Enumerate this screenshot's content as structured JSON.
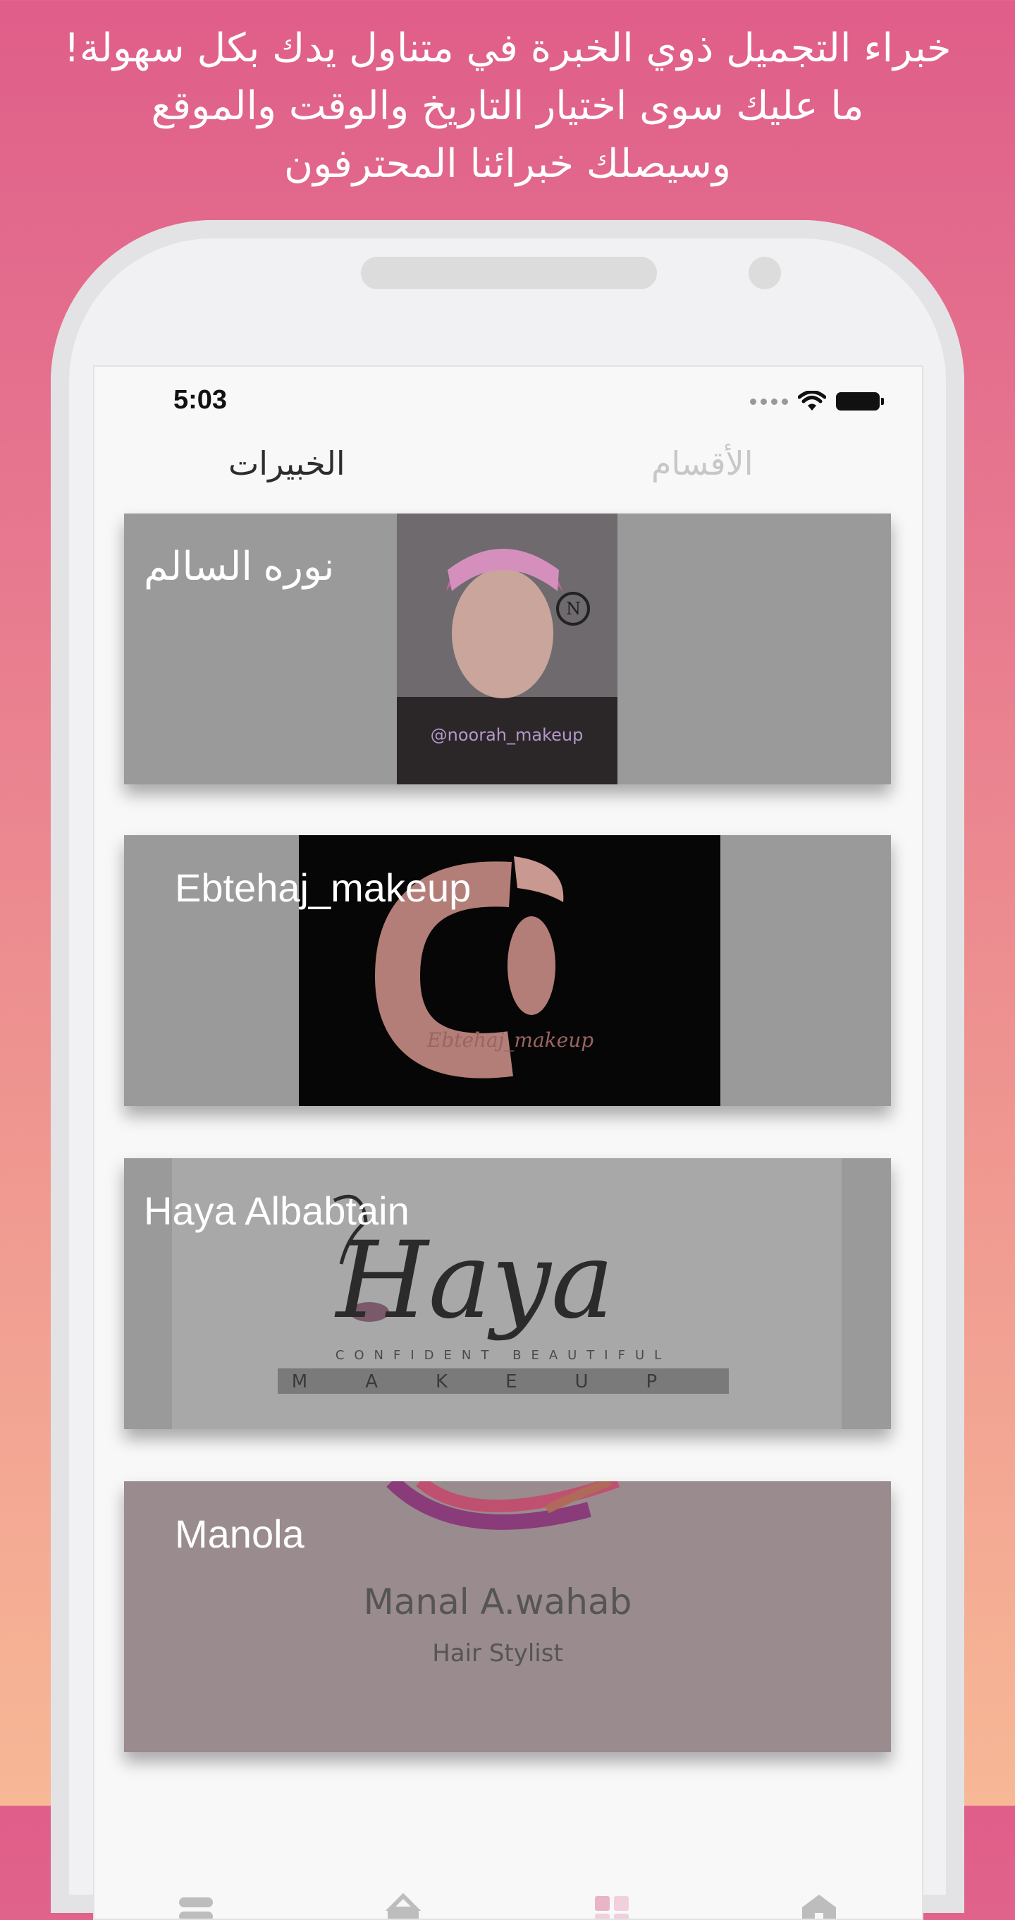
{
  "promo": {
    "lines": [
      "خبراء التجميل ذوي الخبرة في متناول يدك بكل سهولة!",
      "ما عليك سوى اختيار التاريخ والوقت والموقع",
      "وسيصلك خبرائنا المحترفون"
    ]
  },
  "status_bar": {
    "time": "5:03"
  },
  "tabs": {
    "experts": "الخبيرات",
    "sections": "الأقسام",
    "active": "experts"
  },
  "experts": [
    {
      "name": "نوره السالم",
      "image_caption": "@noorah_makeup"
    },
    {
      "name": "Ebtehaj_makeup",
      "image_caption": "Ebtehaj_makeup"
    },
    {
      "name": "Haya Albabtain",
      "image_title": "Haya",
      "image_tagline": "CONFIDENT BEAUTIFUL",
      "image_word": "MAKEUP"
    },
    {
      "name": "Manola",
      "image_title": "Manal A.wahab",
      "image_subtitle": "Hair Stylist"
    }
  ],
  "colors": {
    "accent_pink": "#df5e8a",
    "card_overlay": "#9a9a9a",
    "active_nav": "#e8b4c6"
  }
}
